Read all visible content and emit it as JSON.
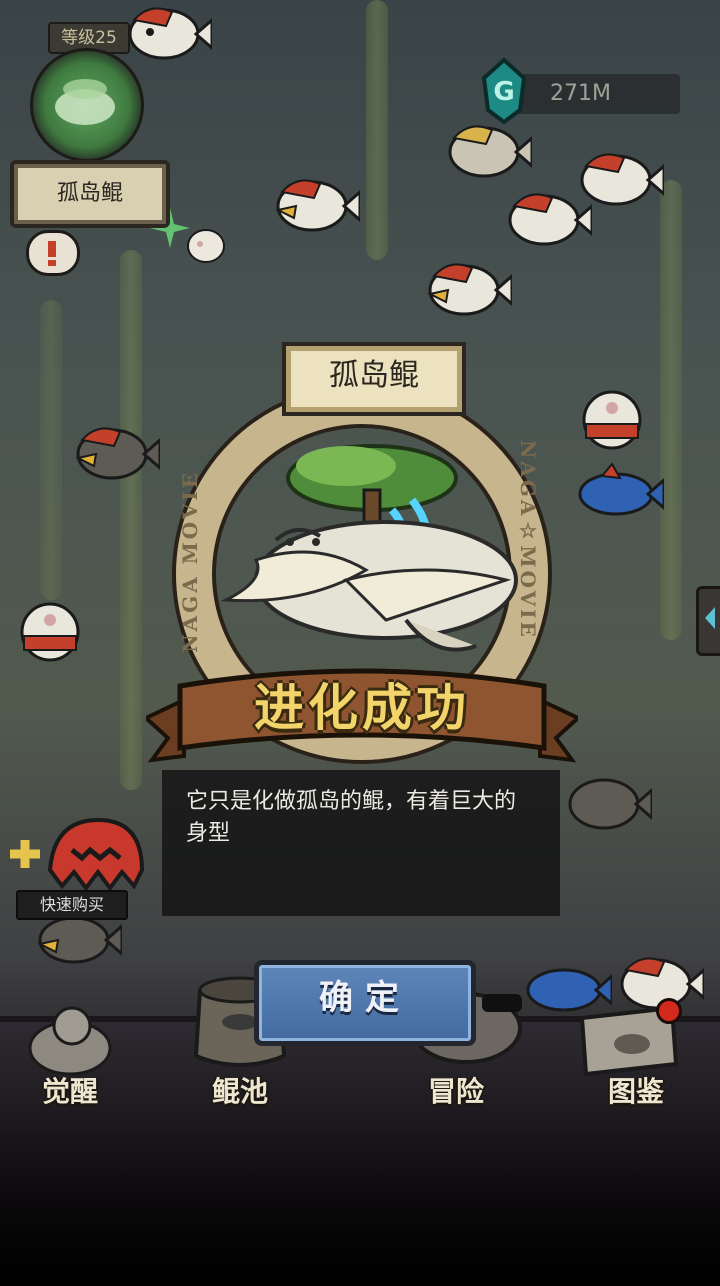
{
  "level": {
    "label": "等级25"
  },
  "current_fish": {
    "name": "孤岛鲲"
  },
  "currency": {
    "amount": "271M"
  },
  "evolution_dialog": {
    "fish_name": "孤岛鲲",
    "ring_text_left": "NAGA MOVIE",
    "ring_text_right": "NAGA☆MOVIE",
    "title": "进化成功",
    "description": "它只是化做孤岛的鲲，有着巨大的身型",
    "confirm_label": "确定"
  },
  "quick_buy": {
    "label": "快速购买"
  },
  "bottom_nav": {
    "items": [
      {
        "label": "觉醒",
        "icon": "awaken-icon"
      },
      {
        "label": "鲲池",
        "icon": "pool-icon"
      },
      {
        "label": "冒险",
        "icon": "adventure-icon"
      },
      {
        "label": "图鉴",
        "icon": "handbook-icon"
      }
    ]
  },
  "colors": {
    "accent_gold": "#f3d46a",
    "confirm_blue": "#4f78ad",
    "parchment": "#ece2bf",
    "notification_red": "#d42a1e"
  }
}
